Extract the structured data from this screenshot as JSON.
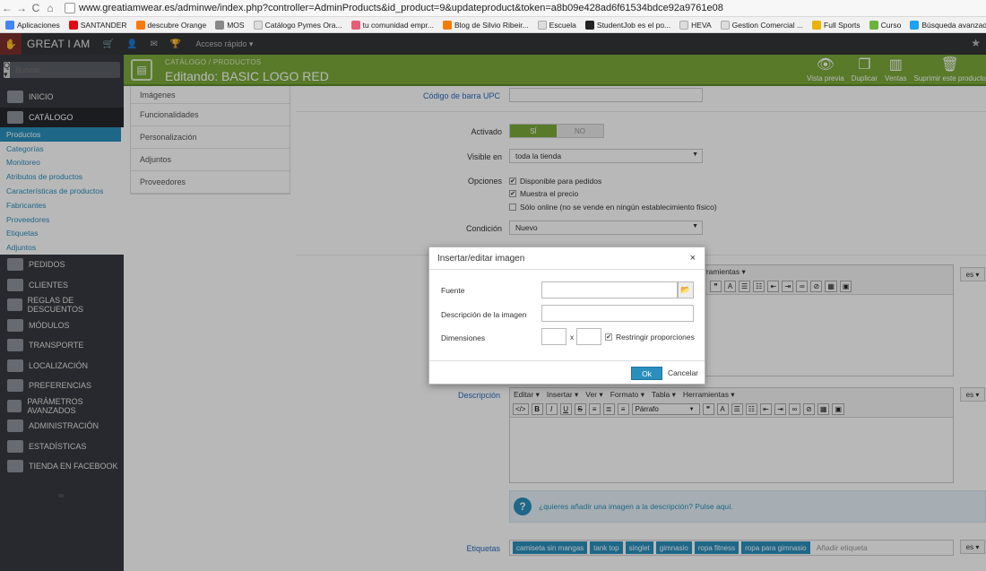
{
  "browser": {
    "url": "www.greatiamwear.es/adminwe/index.php?controller=AdminProducts&id_product=9&updateproduct&token=a8b09e428ad6f61534bdce92a9761e08",
    "bookmarks": [
      "Aplicaciones",
      "SANTANDER",
      "descubre Orange",
      "MOS",
      "Catálogo Pymes Ora...",
      "tu comunidad empr...",
      "Blog de Silvio Ribeir...",
      "Escuela",
      "StudentJob es el po...",
      "HEVA",
      "Gestion Comercial ...",
      "Full Sports",
      "Curso",
      "Búsqueda avanzada ..."
    ]
  },
  "topbar": {
    "brand": "GREAT I AM",
    "quick_access": "Acceso rápido ▾"
  },
  "header": {
    "breadcrumb": "CATÁLOGO  /  PRODUCTOS",
    "title": "Editando: BASIC LOGO RED",
    "actions": [
      {
        "label": "Vista previa",
        "icon": "eye-icon",
        "glyph": "👁"
      },
      {
        "label": "Duplicar",
        "icon": "copy-icon",
        "glyph": "❐"
      },
      {
        "label": "Ventas",
        "icon": "bar-chart-icon",
        "glyph": "▥"
      },
      {
        "label": "Suprimir este producto",
        "icon": "trash-icon",
        "glyph": "🗑"
      }
    ]
  },
  "sidebar": {
    "search_placeholder": "Buscar",
    "search_btn": "Q ▾",
    "menu_top": [
      "Inicio",
      "Catálogo"
    ],
    "submenu": [
      "Productos",
      "Categorías",
      "Monitoreo",
      "Atributos de productos",
      "Características de productos",
      "Fabricantes",
      "Proveedores",
      "Etiquetas",
      "Adjuntos"
    ],
    "menu_bottom": [
      "Pedidos",
      "Clientes",
      "Reglas de descuentos",
      "Módulos",
      "Transporte",
      "Localización",
      "Preferencias",
      "Parámetros avanzados",
      "Administración",
      "Estadísticas",
      "Tienda en Facebook"
    ]
  },
  "tabs": [
    "Imágenes",
    "Funcionalidades",
    "Personalización",
    "Adjuntos",
    "Proveedores"
  ],
  "form": {
    "upc_label": "Código de barra UPC",
    "activado_label": "Activado",
    "toggle_yes": "SÍ",
    "toggle_no": "NO",
    "visible_label": "Visible en",
    "visible_value": "toda la tienda",
    "opciones_label": "Opciones",
    "opt1": "Disponible para pedidos",
    "opt2": "Muestra el precio",
    "opt3": "Sólo online (no se vende en ningún establecimiento físico)",
    "condicion_label": "Condición",
    "condicion_value": "Nuevo",
    "descripcion_label": "Descripción",
    "lang": "es ▾",
    "editor_menu": [
      "Editar ▾",
      "Insertar ▾",
      "Ver ▾",
      "Formato ▾",
      "Tabla ▾",
      "Herramientas ▾"
    ],
    "editor_menu_partial": "rramientas ▾",
    "format_select": "Párrafo",
    "hint": "¿quieres añadir una imagen a la descripción? Pulse aquí.",
    "etiquetas_label": "Etiquetas",
    "tags": [
      "camiseta sin mangas",
      "tank top",
      "singlet",
      "gimnasio",
      "ropa fitness",
      "ropa para gimnasio"
    ],
    "tag_placeholder": "Añadir etiqueta"
  },
  "modal": {
    "title": "Insertar/editar imagen",
    "close": "×",
    "fuente_label": "Fuente",
    "desc_label": "Descripción de la imagen",
    "dim_label": "Dimensiones",
    "dim_x": "x",
    "restrict_label": "Restringir proporciones",
    "ok": "Ok",
    "cancel": "Cancelar"
  }
}
